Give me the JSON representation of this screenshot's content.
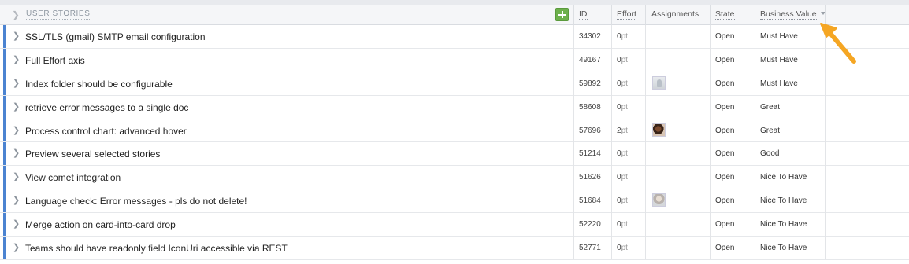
{
  "header": {
    "title": "USER STORIES",
    "columns": {
      "id": "ID",
      "effort": "Effort",
      "assignments": "Assignments",
      "state": "State",
      "business_value": "Business Value"
    }
  },
  "rows": [
    {
      "name": "SSL/TLS (gmail) SMTP email configuration",
      "id": "34302",
      "effort": "0",
      "unit": "pt",
      "state": "Open",
      "business_value": "Must Have",
      "avatar": "none"
    },
    {
      "name": "Full Effort axis",
      "id": "49167",
      "effort": "0",
      "unit": "pt",
      "state": "Open",
      "business_value": "Must Have",
      "avatar": "none"
    },
    {
      "name": "Index folder should be configurable",
      "id": "59892",
      "effort": "0",
      "unit": "pt",
      "state": "Open",
      "business_value": "Must Have",
      "avatar": "ghost"
    },
    {
      "name": "retrieve error messages to a single doc",
      "id": "58608",
      "effort": "0",
      "unit": "pt",
      "state": "Open",
      "business_value": "Great",
      "avatar": "none"
    },
    {
      "name": "Process control chart: advanced hover",
      "id": "57696",
      "effort": "2",
      "unit": "pt",
      "state": "Open",
      "business_value": "Great",
      "avatar": "photo"
    },
    {
      "name": "Preview several selected stories",
      "id": "51214",
      "effort": "0",
      "unit": "pt",
      "state": "Open",
      "business_value": "Good",
      "avatar": "none"
    },
    {
      "name": "View comet integration",
      "id": "51626",
      "effort": "0",
      "unit": "pt",
      "state": "Open",
      "business_value": "Nice To Have",
      "avatar": "none"
    },
    {
      "name": "Language check: Error messages - pls do not delete!",
      "id": "51684",
      "effort": "0",
      "unit": "pt",
      "state": "Open",
      "business_value": "Nice To Have",
      "avatar": "grey"
    },
    {
      "name": "Merge action on card-into-card drop",
      "id": "52220",
      "effort": "0",
      "unit": "pt",
      "state": "Open",
      "business_value": "Nice To Have",
      "avatar": "none"
    },
    {
      "name": "Teams should have readonly field IconUri accessible via REST",
      "id": "52771",
      "effort": "0",
      "unit": "pt",
      "state": "Open",
      "business_value": "Nice To Have",
      "avatar": "none"
    }
  ],
  "colors": {
    "row_bar": "#4b83d1",
    "add_button": "#6db04c",
    "annotation_arrow": "#f5a623"
  },
  "icons": {
    "expand": "chevron-right-icon",
    "add": "plus-icon",
    "sort": "sort-desc-icon",
    "annotation": "arrow-icon"
  }
}
